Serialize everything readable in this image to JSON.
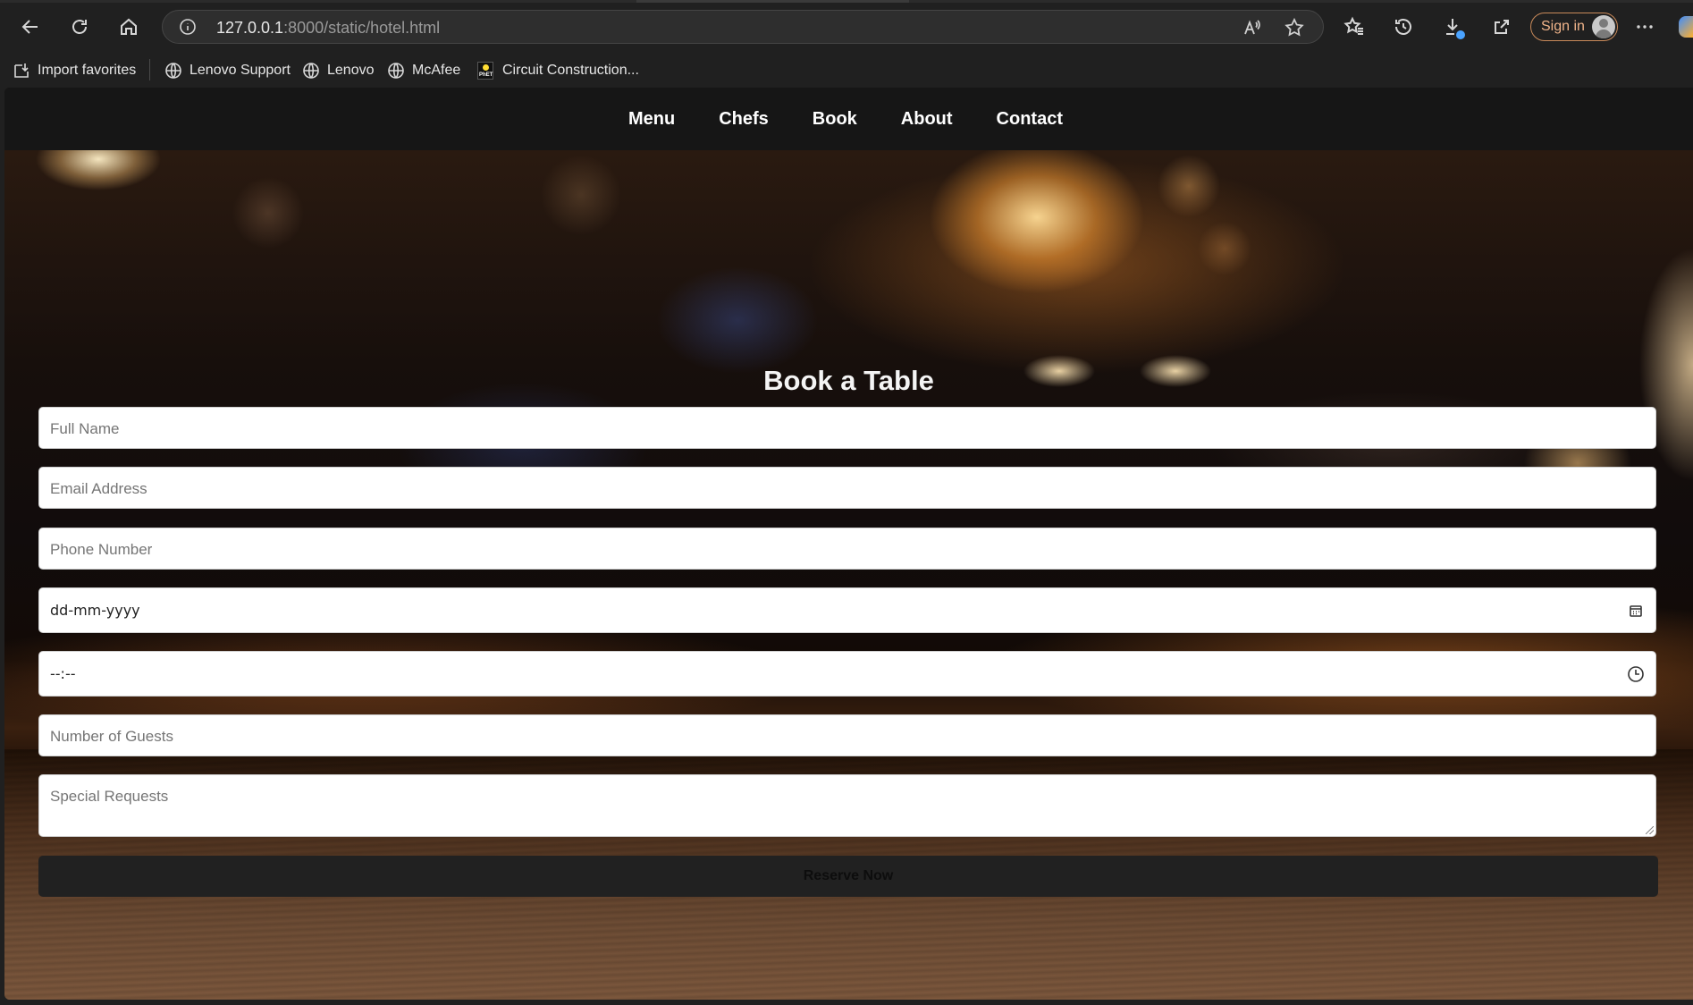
{
  "browser": {
    "url_host": "127.0.0.1",
    "url_rest": ":8000/static/hotel.html",
    "signin_label": "Sign in",
    "icons": [
      "back-icon",
      "refresh-icon",
      "home-icon",
      "site-info-icon",
      "read-aloud-icon",
      "favorite-star-icon",
      "favorites-icon",
      "history-icon",
      "downloads-icon",
      "share-icon",
      "more-icon"
    ]
  },
  "bookmarks": [
    {
      "label": "Import favorites",
      "icon": "import-icon"
    },
    {
      "label": "Lenovo Support",
      "icon": "globe-icon"
    },
    {
      "label": "Lenovo",
      "icon": "globe-icon"
    },
    {
      "label": "McAfee",
      "icon": "globe-icon"
    },
    {
      "label": "Circuit Construction...",
      "icon": "phet-icon"
    }
  ],
  "nav": {
    "items": [
      {
        "label": "Menu"
      },
      {
        "label": "Chefs"
      },
      {
        "label": "Book"
      },
      {
        "label": "About"
      },
      {
        "label": "Contact"
      }
    ]
  },
  "booking": {
    "title": "Book a Table",
    "full_name_placeholder": "Full Name",
    "email_placeholder": "Email Address",
    "phone_placeholder": "Phone Number",
    "date_placeholder": "dd-mm-yyyy",
    "time_placeholder": "--:--",
    "guests_placeholder": "Number of Guests",
    "requests_placeholder": "Special Requests",
    "submit_label": "Reserve Now"
  },
  "colors": {
    "navbar_bg": "#161616",
    "button_bg": "#212121",
    "signin_accent": "#f0b48a"
  }
}
